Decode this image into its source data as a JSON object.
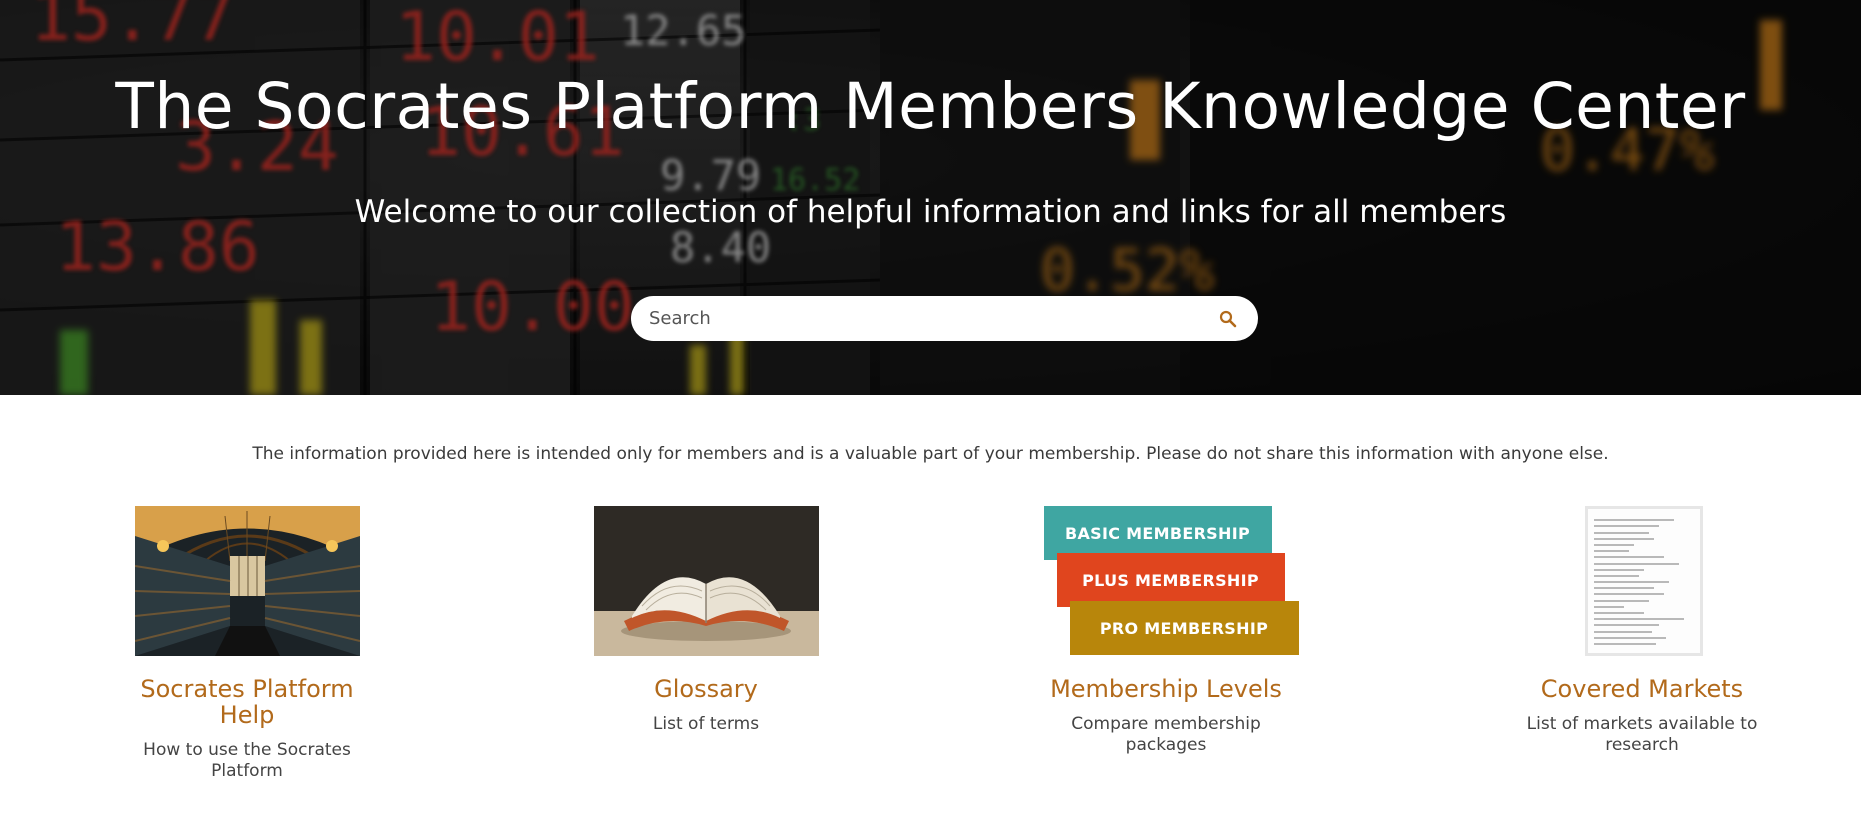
{
  "hero": {
    "title": "The Socrates Platform Members Knowledge Center",
    "subtitle": "Welcome to our collection of helpful information and links for all members",
    "board_numbers_red": [
      "10.01",
      "3.24",
      "13.86",
      "10.00",
      "10.61",
      "15.77"
    ],
    "board_numbers_white": [
      "12.65",
      "9.79",
      "8.40"
    ],
    "board_numbers_orange": [
      "0.52%",
      "0.47%"
    ]
  },
  "search": {
    "placeholder": "Search",
    "icon": "search-icon",
    "icon_color": "#b26a1b"
  },
  "notice": "The information provided here is intended only for members and is a valuable part of your membership. Please do not share this information with anyone else.",
  "cards": [
    {
      "title": "Socrates Platform Help",
      "description": "How to use the Socrates Platform",
      "image": "library-image"
    },
    {
      "title": "Glossary",
      "description": "List of terms",
      "image": "open-book-image"
    },
    {
      "title": "Membership Levels",
      "description": "Compare membership packages",
      "image": "membership-tags-image",
      "tags": [
        "BASIC MEMBERSHIP",
        "PLUS MEMBERSHIP",
        "PRO MEMBERSHIP"
      ]
    },
    {
      "title": "Covered Markets",
      "description": "List of markets available to research",
      "image": "markets-list-image"
    }
  ],
  "colors": {
    "accent": "#b26a1b",
    "tag_basic": "#3fa6a2",
    "tag_plus": "#e0451e",
    "tag_pro": "#b8860b"
  }
}
